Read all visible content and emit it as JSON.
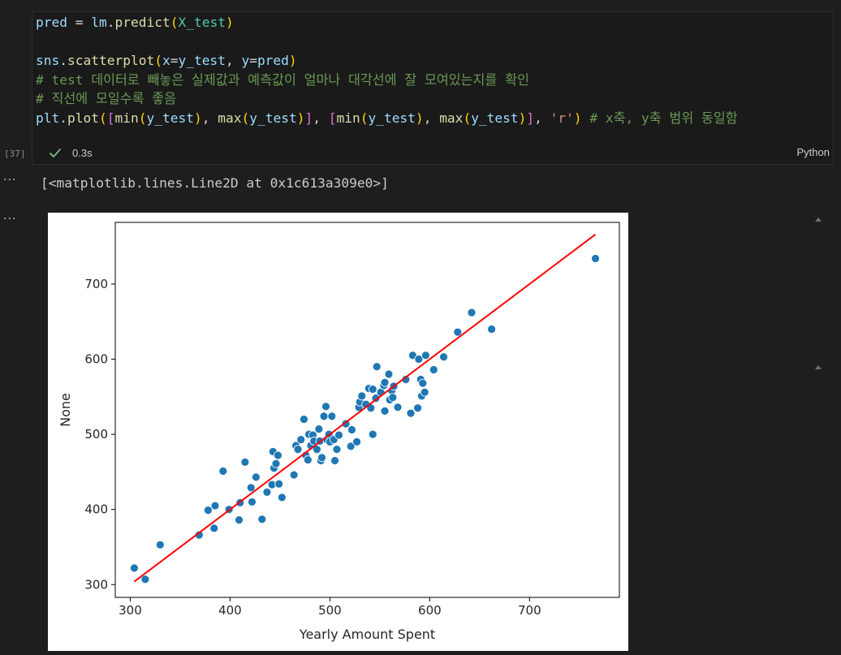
{
  "cell": {
    "execution_count": "[37]",
    "code_lines": [
      [
        [
          "pred",
          "kw-var"
        ],
        [
          " = ",
          "kw-op"
        ],
        [
          "lm",
          "kw-var"
        ],
        [
          ".",
          "kw-op"
        ],
        [
          "predict",
          "kw-fn"
        ],
        [
          "(",
          "kw-br1"
        ],
        [
          "X_test",
          "kw-mod"
        ],
        [
          ")",
          "kw-br1"
        ]
      ],
      [],
      [
        [
          "sns",
          "kw-var"
        ],
        [
          ".",
          "kw-op"
        ],
        [
          "scatterplot",
          "kw-fn"
        ],
        [
          "(",
          "kw-br1"
        ],
        [
          "x",
          "kw-var"
        ],
        [
          "=",
          "kw-op"
        ],
        [
          "y_test",
          "kw-var"
        ],
        [
          ", ",
          "kw-op"
        ],
        [
          "y",
          "kw-var"
        ],
        [
          "=",
          "kw-op"
        ],
        [
          "pred",
          "kw-var"
        ],
        [
          ")",
          "kw-br1"
        ]
      ],
      [
        [
          "# test 데이터로 빼놓은 실제값과 예측값이 얼마나 대각선에 잘 모여있는지를 확인",
          "kw-cmt"
        ]
      ],
      [
        [
          "# 직선에 모일수록 좋음",
          "kw-cmt"
        ]
      ],
      [
        [
          "plt",
          "kw-var"
        ],
        [
          ".",
          "kw-op"
        ],
        [
          "plot",
          "kw-fn"
        ],
        [
          "(",
          "kw-br1"
        ],
        [
          "[",
          "kw-br2"
        ],
        [
          "min",
          "kw-fn"
        ],
        [
          "(",
          "kw-br1"
        ],
        [
          "y_test",
          "kw-var"
        ],
        ")",
        [
          "",
          "kw-op"
        ]
      ],
      []
    ],
    "code_raw": [
      "pred = lm.predict(X_test)",
      "",
      "sns.scatterplot(x=y_test, y=pred)",
      "# test 데이터로 빼놓은 실제값과 예측값이 얼마나 대각선에 잘 모여있는지를 확인",
      "# 직선에 모일수록 좋음",
      "plt.plot([min(y_test), max(y_test)], [min(y_test), max(y_test)], 'r') # x축, y축 범위 동일함"
    ],
    "status": "success",
    "exec_time": "0.3s",
    "language": "Python"
  },
  "output": {
    "text": "[<matplotlib.lines.Line2D at 0x1c613a309e0>]",
    "more_icon": "···"
  },
  "chart_data": {
    "type": "scatter",
    "title": "",
    "xlabel": "Yearly Amount Spent",
    "ylabel": "None",
    "xlim": [
      285,
      790
    ],
    "ylim": [
      283,
      782
    ],
    "xticks": [
      300,
      400,
      500,
      600,
      700
    ],
    "yticks": [
      300,
      400,
      500,
      600,
      700
    ],
    "grid": false,
    "point_color": "#1f77b4",
    "line_color": "#ff0000",
    "points": [
      [
        304,
        322
      ],
      [
        315,
        307
      ],
      [
        330,
        353
      ],
      [
        369,
        366
      ],
      [
        378,
        399
      ],
      [
        385,
        405
      ],
      [
        384,
        375
      ],
      [
        393,
        451
      ],
      [
        399,
        400
      ],
      [
        409,
        386
      ],
      [
        410,
        409
      ],
      [
        415,
        463
      ],
      [
        421,
        429
      ],
      [
        422,
        410
      ],
      [
        426,
        443
      ],
      [
        432,
        387
      ],
      [
        437,
        423
      ],
      [
        442,
        433
      ],
      [
        443,
        477
      ],
      [
        444,
        455
      ],
      [
        446,
        461
      ],
      [
        448,
        472
      ],
      [
        449,
        434
      ],
      [
        452,
        416
      ],
      [
        464,
        446
      ],
      [
        466,
        485
      ],
      [
        468,
        480
      ],
      [
        471,
        493
      ],
      [
        474,
        520
      ],
      [
        476,
        472
      ],
      [
        478,
        466
      ],
      [
        479,
        500
      ],
      [
        481,
        485
      ],
      [
        483,
        499
      ],
      [
        484,
        491
      ],
      [
        487,
        480
      ],
      [
        489,
        507
      ],
      [
        490,
        491
      ],
      [
        491,
        465
      ],
      [
        492,
        469
      ],
      [
        494,
        524
      ],
      [
        496,
        537
      ],
      [
        497,
        493
      ],
      [
        499,
        500
      ],
      [
        500,
        490
      ],
      [
        502,
        524
      ],
      [
        504,
        493
      ],
      [
        505,
        465
      ],
      [
        507,
        480
      ],
      [
        509,
        499
      ],
      [
        516,
        514
      ],
      [
        521,
        484
      ],
      [
        522,
        506
      ],
      [
        527,
        490
      ],
      [
        529,
        536
      ],
      [
        530,
        543
      ],
      [
        532,
        551
      ],
      [
        536,
        540
      ],
      [
        539,
        561
      ],
      [
        541,
        535
      ],
      [
        543,
        500
      ],
      [
        543,
        560
      ],
      [
        546,
        548
      ],
      [
        547,
        590
      ],
      [
        551,
        556
      ],
      [
        554,
        565
      ],
      [
        555,
        531
      ],
      [
        555,
        569
      ],
      [
        559,
        580
      ],
      [
        560,
        546
      ],
      [
        562,
        558
      ],
      [
        563,
        549
      ],
      [
        564,
        564
      ],
      [
        568,
        536
      ],
      [
        576,
        573
      ],
      [
        581,
        528
      ],
      [
        583,
        605
      ],
      [
        588,
        535
      ],
      [
        589,
        600
      ],
      [
        591,
        573
      ],
      [
        592,
        551
      ],
      [
        593,
        568
      ],
      [
        595,
        556
      ],
      [
        596,
        605
      ],
      [
        604,
        586
      ],
      [
        614,
        603
      ],
      [
        628,
        636
      ],
      [
        642,
        662
      ],
      [
        662,
        640
      ],
      [
        766,
        734
      ]
    ],
    "line": {
      "x": [
        304,
        766
      ],
      "y": [
        304,
        766
      ]
    }
  }
}
